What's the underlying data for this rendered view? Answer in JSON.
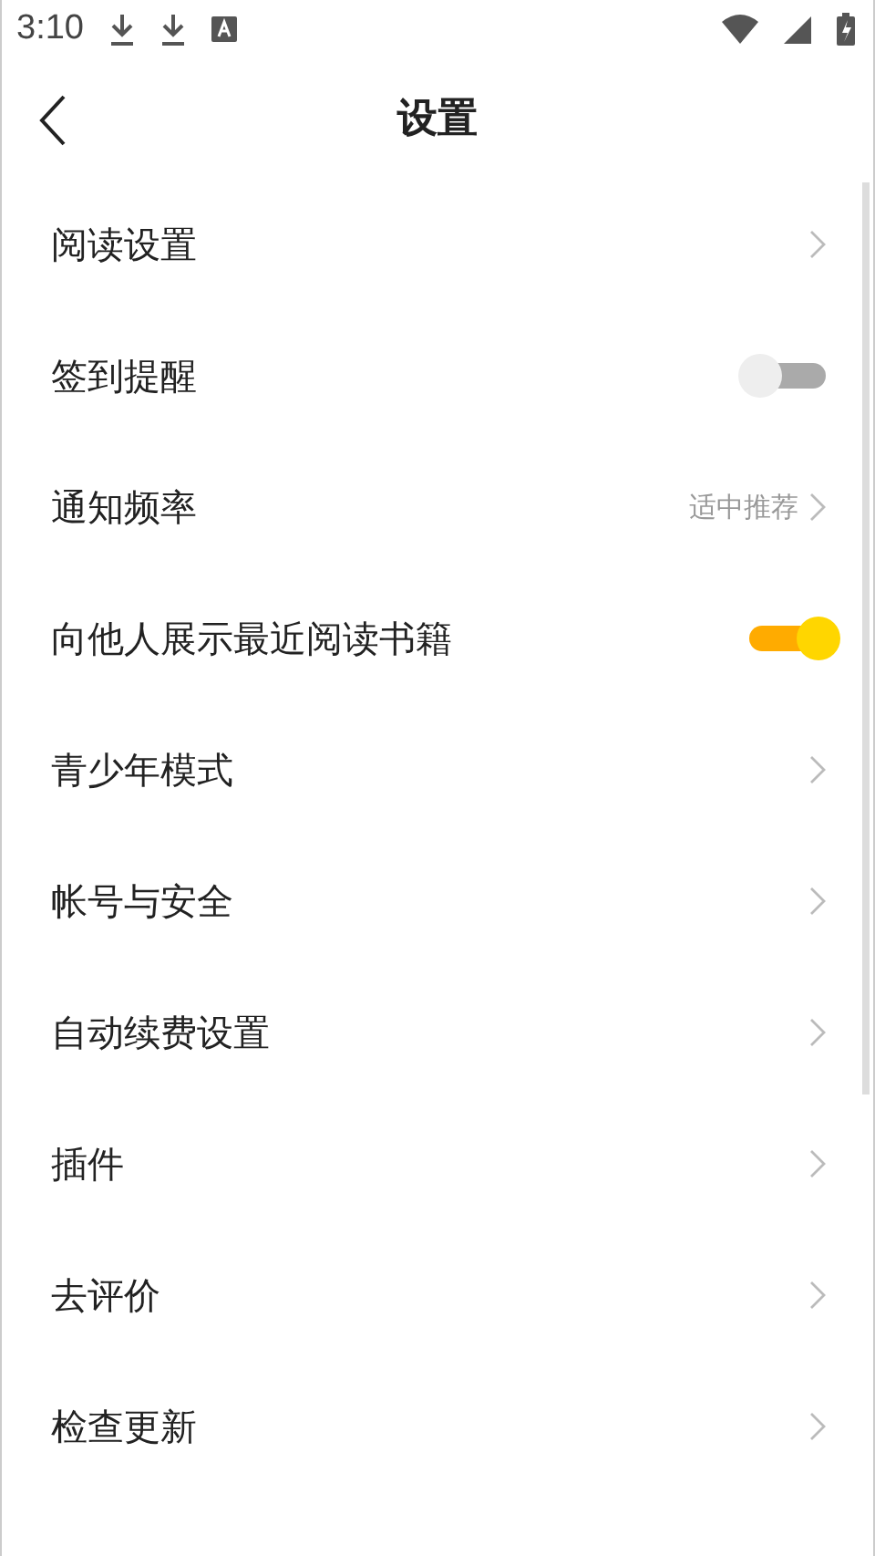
{
  "status_bar": {
    "time": "3:10"
  },
  "header": {
    "title": "设置"
  },
  "items": [
    {
      "kind": "link",
      "label": "阅读设置"
    },
    {
      "kind": "toggle",
      "label": "签到提醒",
      "on": false
    },
    {
      "kind": "link",
      "label": "通知频率",
      "value": "适中推荐"
    },
    {
      "kind": "toggle",
      "label": "向他人展示最近阅读书籍",
      "on": true
    },
    {
      "kind": "link",
      "label": "青少年模式"
    },
    {
      "kind": "link",
      "label": "帐号与安全"
    },
    {
      "kind": "link",
      "label": "自动续费设置"
    },
    {
      "kind": "link",
      "label": "插件"
    },
    {
      "kind": "link",
      "label": "去评价"
    },
    {
      "kind": "link",
      "label": "检查更新"
    }
  ]
}
